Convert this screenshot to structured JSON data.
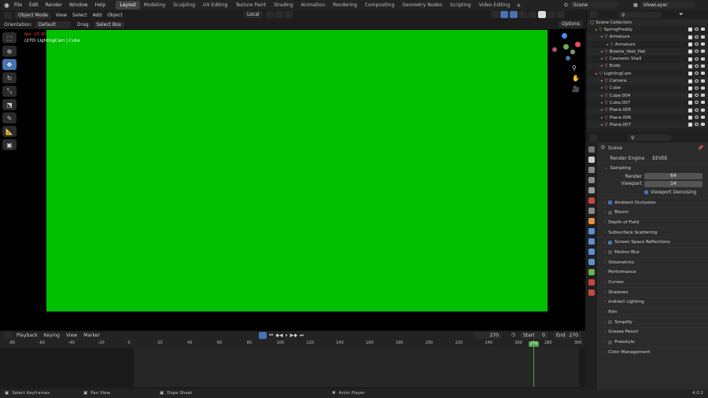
{
  "app": {
    "menu": [
      "File",
      "Edit",
      "Render",
      "Window",
      "Help"
    ],
    "workspaces": [
      "Layout",
      "Modeling",
      "Sculpting",
      "UV Editing",
      "Texture Paint",
      "Shading",
      "Animation",
      "Rendering",
      "Compositing",
      "Geometry Nodes",
      "Scripting",
      "Video Editing"
    ],
    "active_workspace": "Layout",
    "add_tab": "+",
    "scene": "Scene",
    "view_layer": "ViewLayer"
  },
  "viewport": {
    "mode": "Object Mode",
    "menus": [
      "View",
      "Select",
      "Add",
      "Object"
    ],
    "transform_orientation": "Local",
    "orientation_label": "Orientation:",
    "orientation_value": "Default",
    "drag_label": "Drag:",
    "drag_value": "Select Box",
    "options": "Options",
    "fps": "fps: 23.30",
    "info": "(270) LightingCam | Cube",
    "background_color": "#00c000"
  },
  "outliner": {
    "root": "Scene Collection",
    "rows": [
      {
        "name": "SpringFreddy",
        "indent": 1
      },
      {
        "name": "Armature",
        "indent": 2
      },
      {
        "name": "Armature",
        "indent": 3
      },
      {
        "name": "Bowtie_Vest_Hat",
        "indent": 2
      },
      {
        "name": "Cosmetic Shell",
        "indent": 2
      },
      {
        "name": "Endo",
        "indent": 2
      },
      {
        "name": "LightingCam",
        "indent": 1
      },
      {
        "name": "Camera",
        "indent": 2
      },
      {
        "name": "Cube",
        "indent": 2
      },
      {
        "name": "Cube.004",
        "indent": 2
      },
      {
        "name": "Cube.007",
        "indent": 2
      },
      {
        "name": "Plane.005",
        "indent": 2
      },
      {
        "name": "Plane.006",
        "indent": 2
      },
      {
        "name": "Plane.007",
        "indent": 2
      }
    ]
  },
  "properties": {
    "context": "Scene",
    "render_engine_label": "Render Engine",
    "render_engine": "EEVEE",
    "sampling": "Sampling",
    "render_label": "Render",
    "render_samples": "64",
    "viewport_label": "Viewport",
    "viewport_samples": "14",
    "viewport_denoising": "Viewport Denoising",
    "sections": [
      {
        "label": "Ambient Occlusion",
        "checkbox": "on"
      },
      {
        "label": "Bloom",
        "checkbox": "off"
      },
      {
        "label": "Depth of Field",
        "checkbox": "none"
      },
      {
        "label": "Subsurface Scattering",
        "checkbox": "none"
      },
      {
        "label": "Screen Space Reflections",
        "checkbox": "on"
      },
      {
        "label": "Motion Blur",
        "checkbox": "off"
      },
      {
        "label": "Volumetrics",
        "checkbox": "none"
      },
      {
        "label": "Performance",
        "checkbox": "none"
      },
      {
        "label": "Curves",
        "checkbox": "none"
      },
      {
        "label": "Shadows",
        "checkbox": "none"
      },
      {
        "label": "Indirect Lighting",
        "checkbox": "none"
      },
      {
        "label": "Film",
        "checkbox": "none"
      },
      {
        "label": "Simplify",
        "checkbox": "off"
      },
      {
        "label": "Grease Pencil",
        "checkbox": "none"
      },
      {
        "label": "Freestyle",
        "checkbox": "off"
      },
      {
        "label": "Color Management",
        "checkbox": "none"
      }
    ]
  },
  "timeline": {
    "menus": [
      "Playback",
      "Keying",
      "View",
      "Marker"
    ],
    "current_frame": "270",
    "start_label": "Start",
    "start": "0",
    "end_label": "End",
    "end": "270",
    "ruler": [
      "-80",
      "-60",
      "-40",
      "-20",
      "0",
      "20",
      "40",
      "60",
      "80",
      "100",
      "120",
      "140",
      "160",
      "180",
      "200",
      "220",
      "240",
      "260",
      "280",
      "300"
    ]
  },
  "statusbar": {
    "items": [
      "Select Keyframes",
      "Pan View",
      "Dope Sheet",
      "Anim Player"
    ],
    "version": "4.0.2"
  }
}
